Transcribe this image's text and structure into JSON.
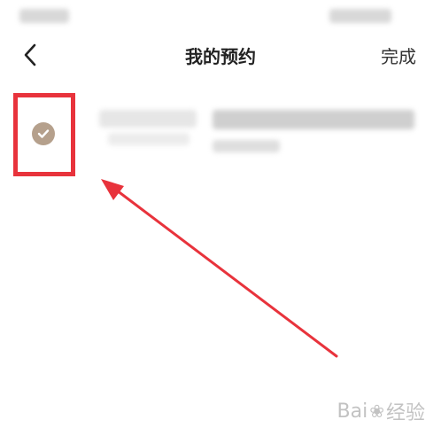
{
  "nav": {
    "title": "我的预约",
    "done_label": "完成"
  },
  "watermark": {
    "text_left": "Bai",
    "text_right": "经验"
  },
  "colors": {
    "check_fill": "#b5a08c",
    "highlight": "#e8333c"
  },
  "icons": {
    "back": "chevron-left",
    "check": "checkmark-circle"
  }
}
